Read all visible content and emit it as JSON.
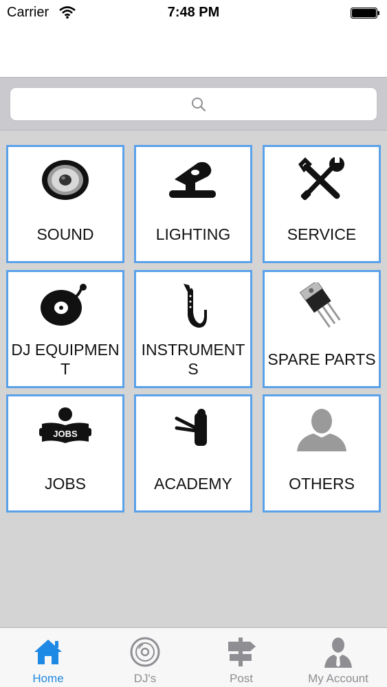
{
  "status_bar": {
    "carrier": "Carrier",
    "time": "7:48 PM"
  },
  "search": {
    "placeholder": ""
  },
  "colors": {
    "tile_border": "#5aa1ea",
    "active_tab": "#1e88e5",
    "inactive_tab": "#8e8e93"
  },
  "categories": [
    {
      "label": "SOUND",
      "icon": "speaker-icon"
    },
    {
      "label": "LIGHTING",
      "icon": "stage-light-icon"
    },
    {
      "label": "SERVICE",
      "icon": "wrench-screwdriver-icon"
    },
    {
      "label": "DJ EQUIPMENT",
      "icon": "turntable-icon"
    },
    {
      "label": "INSTRUMENTS",
      "icon": "saxophone-icon"
    },
    {
      "label": "SPARE PARTS",
      "icon": "transistor-icon"
    },
    {
      "label": "JOBS",
      "icon": "jobs-icon"
    },
    {
      "label": "ACADEMY",
      "icon": "academy-icon"
    },
    {
      "label": "OTHERS",
      "icon": "person-icon"
    }
  ],
  "tabs": [
    {
      "label": "Home",
      "icon": "home-icon",
      "active": true
    },
    {
      "label": "DJ's",
      "icon": "vinyl-icon",
      "active": false
    },
    {
      "label": "Post",
      "icon": "signpost-icon",
      "active": false
    },
    {
      "label": "My Account",
      "icon": "account-icon",
      "active": false
    }
  ]
}
